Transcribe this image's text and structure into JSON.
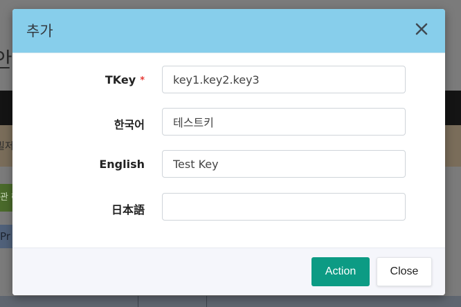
{
  "background": {
    "heading_fragment": "안",
    "notice_fragment": "빌저",
    "green_button_fragment": "관 해",
    "blue_button_fragment": "Pr"
  },
  "modal": {
    "title": "추가",
    "close_icon": "close-icon",
    "header_color": "#87ceeb",
    "fields": [
      {
        "label": "TKey",
        "required_mark": "*",
        "value": "key1.key2.key3",
        "placeholder": ""
      },
      {
        "label": "한국어",
        "value": "테스트키",
        "placeholder": ""
      },
      {
        "label": "English",
        "value": "Test Key",
        "placeholder": ""
      },
      {
        "label": "日本語",
        "value": "",
        "placeholder": ""
      }
    ],
    "footer": {
      "action_label": "Action",
      "close_label": "Close",
      "action_color": "#0c9b84"
    }
  }
}
